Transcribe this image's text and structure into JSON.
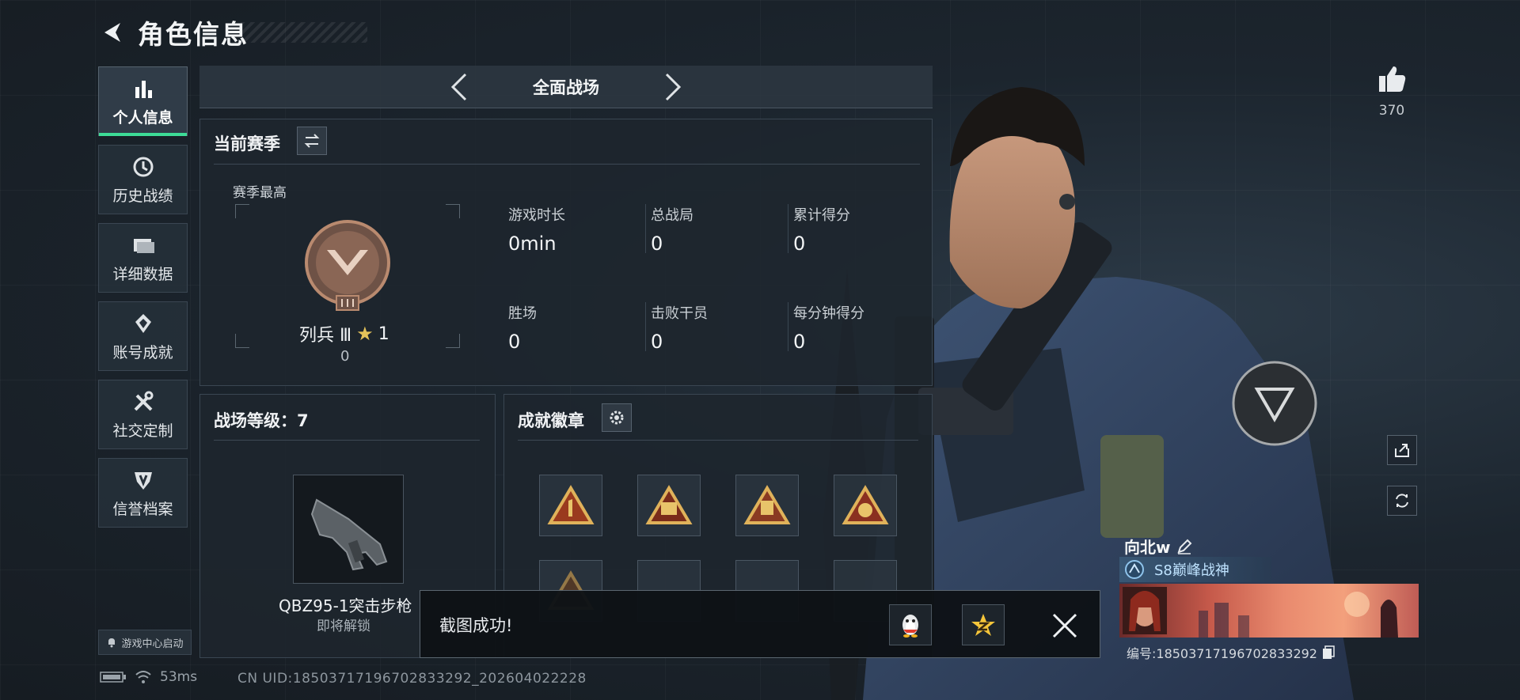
{
  "header": {
    "title": "角色信息"
  },
  "sidebar": {
    "items": [
      {
        "label": "个人信息",
        "icon": "bar-chart-icon",
        "active": true
      },
      {
        "label": "历史战绩",
        "icon": "history-clock-icon"
      },
      {
        "label": "详细数据",
        "icon": "folder-icon"
      },
      {
        "label": "账号成就",
        "icon": "achievement-icon"
      },
      {
        "label": "社交定制",
        "icon": "tools-icon"
      },
      {
        "label": "信誉档案",
        "icon": "credit-shield-icon"
      }
    ],
    "launch_label": "游戏中心启动"
  },
  "mode_selector": {
    "label": "全面战场"
  },
  "season": {
    "title": "当前赛季",
    "season_high_label": "赛季最高",
    "rank_name": "列兵 Ⅲ",
    "rank_stars": "1",
    "rank_points": "0",
    "stats": [
      {
        "label": "游戏时长",
        "value": "0min"
      },
      {
        "label": "总战局",
        "value": "0"
      },
      {
        "label": "累计得分",
        "value": "0"
      },
      {
        "label": "胜场",
        "value": "0"
      },
      {
        "label": "击败干员",
        "value": "0"
      },
      {
        "label": "每分钟得分",
        "value": "0"
      }
    ]
  },
  "battlefield_level": {
    "title": "战场等级：7",
    "weapon_name": "QBZ95-1突击步枪",
    "weapon_status": "即将解锁"
  },
  "achievements": {
    "title": "成就徽章"
  },
  "toast": {
    "message": "截图成功!"
  },
  "like": {
    "count": "370"
  },
  "player": {
    "name": "向北w",
    "title_tag": "S8巅峰战神",
    "card_id": "编号:18503717196702833292"
  },
  "status": {
    "ping": "53ms",
    "cn_uid": "CN UID:18503717196702833292_202604022228"
  },
  "colors": {
    "accent_green": "#3ddc97",
    "gold": "#e4c35a",
    "background": "#1a2128"
  }
}
